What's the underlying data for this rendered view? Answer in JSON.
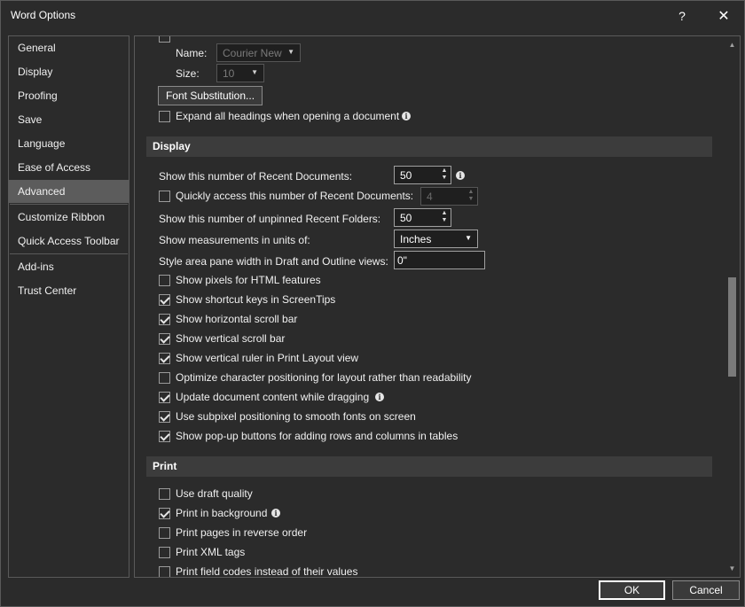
{
  "window": {
    "title": "Word Options"
  },
  "titlebar": {
    "help": "?",
    "close": "✕"
  },
  "nav": {
    "items": [
      {
        "label": "General"
      },
      {
        "label": "Display"
      },
      {
        "label": "Proofing"
      },
      {
        "label": "Save"
      },
      {
        "label": "Language"
      },
      {
        "label": "Ease of Access"
      },
      {
        "label": "Advanced",
        "active": true
      },
      {
        "label": "Customize Ribbon"
      },
      {
        "label": "Quick Access Toolbar"
      },
      {
        "label": "Add-ins"
      },
      {
        "label": "Trust Center"
      }
    ]
  },
  "font_group": {
    "name_label": "Name:",
    "name_value": "Courier New",
    "size_label": "Size:",
    "size_value": "10",
    "font_sub_button": "Font Substitution...",
    "expand_headings": {
      "label": "Expand all headings when opening a document",
      "checked": false
    }
  },
  "display": {
    "header": "Display",
    "recent_docs": {
      "label": "Show this number of Recent Documents:",
      "value": "50"
    },
    "quick_access": {
      "label": "Quickly access this number of Recent Documents:",
      "value": "4",
      "checked": false
    },
    "recent_folders": {
      "label": "Show this number of unpinned Recent Folders:",
      "value": "50"
    },
    "units": {
      "label": "Show measurements in units of:",
      "value": "Inches"
    },
    "style_area": {
      "label": "Style area pane width in Draft and Outline views:",
      "value": "0\""
    },
    "checks": [
      {
        "label": "Show pixels for HTML features",
        "checked": false
      },
      {
        "label": "Show shortcut keys in ScreenTips",
        "checked": true
      },
      {
        "label": "Show horizontal scroll bar",
        "checked": true
      },
      {
        "label": "Show vertical scroll bar",
        "checked": true
      },
      {
        "label": "Show vertical ruler in Print Layout view",
        "checked": true
      },
      {
        "label": "Optimize character positioning for layout rather than readability",
        "checked": false
      },
      {
        "label": "Update document content while dragging",
        "checked": true,
        "info": true
      },
      {
        "label": "Use subpixel positioning to smooth fonts on screen",
        "checked": true
      },
      {
        "label": "Show pop-up buttons for adding rows and columns in tables",
        "checked": true
      }
    ]
  },
  "print": {
    "header": "Print",
    "checks": [
      {
        "label": "Use draft quality",
        "checked": false
      },
      {
        "label": "Print in background",
        "checked": true,
        "info": true
      },
      {
        "label": "Print pages in reverse order",
        "checked": false
      },
      {
        "label": "Print XML tags",
        "checked": false
      },
      {
        "label": "Print field codes instead of their values",
        "checked": false
      }
    ]
  },
  "footer": {
    "ok": "OK",
    "cancel": "Cancel"
  },
  "icons": {
    "info": "i",
    "chevron_down": "▼",
    "spin_up": "▲",
    "spin_down": "▼",
    "scroll_up": "▲",
    "scroll_down": "▼"
  }
}
